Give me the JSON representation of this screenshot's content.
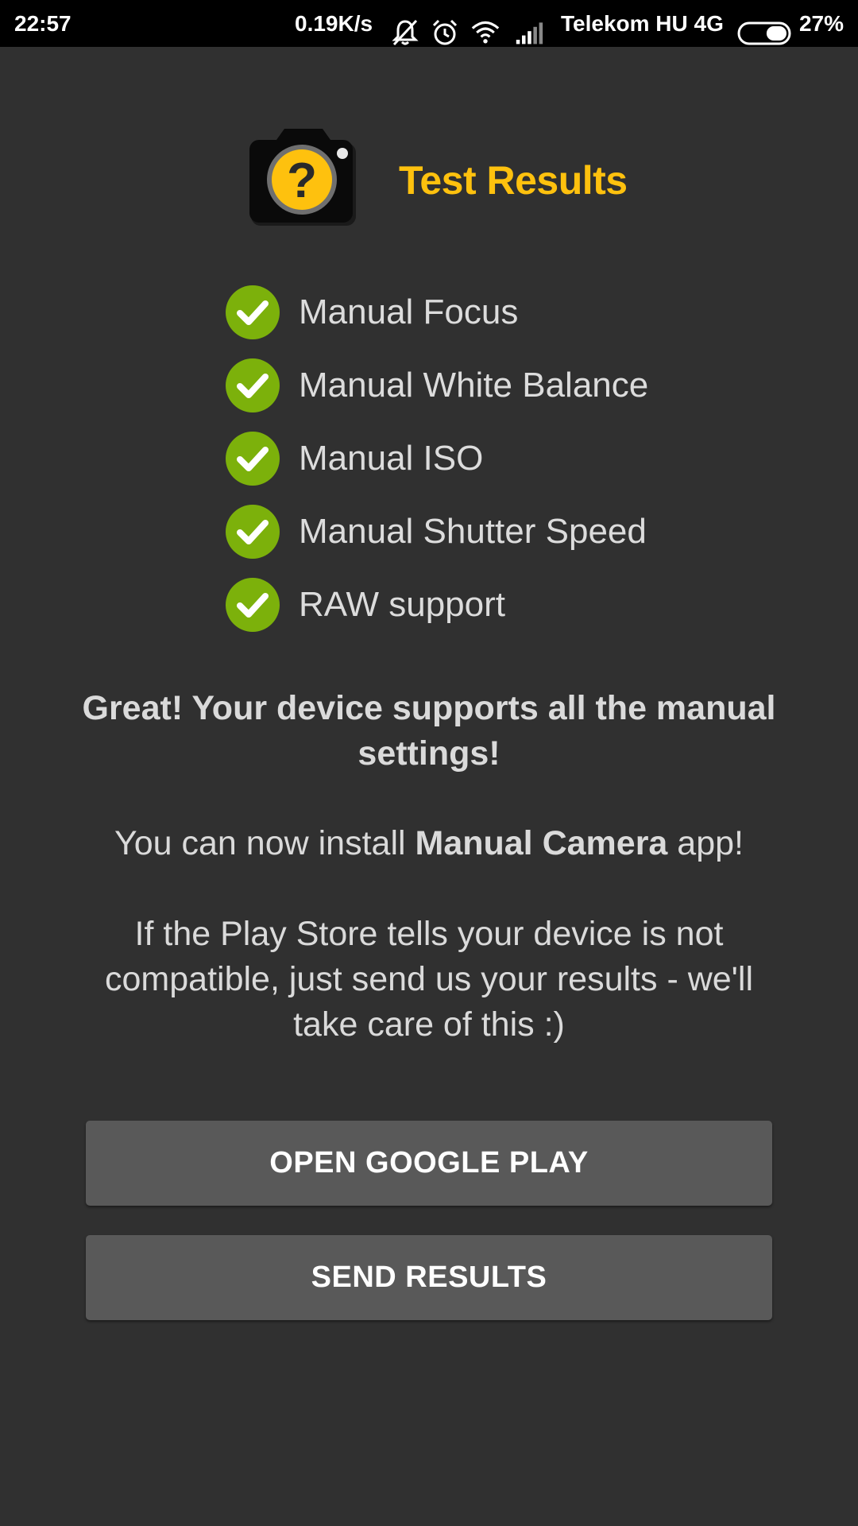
{
  "status_bar": {
    "time": "22:57",
    "net_speed": "0.19K/s",
    "carrier": "Telekom HU 4G",
    "battery_percent": "27%",
    "icons": [
      "mute-icon",
      "alarm-icon",
      "wifi-icon",
      "signal-icon",
      "battery-icon"
    ],
    "battery_level": 0.27
  },
  "header": {
    "title": "Test Results",
    "icon": "camera-question-icon",
    "title_color": "#fec10e"
  },
  "results": [
    {
      "label": "Manual Focus",
      "status": "supported"
    },
    {
      "label": "Manual White Balance",
      "status": "supported"
    },
    {
      "label": "Manual ISO",
      "status": "supported"
    },
    {
      "label": "Manual Shutter Speed",
      "status": "supported"
    },
    {
      "label": "RAW support",
      "status": "supported"
    }
  ],
  "messages": {
    "great": "Great! Your device supports all the manual settings!",
    "install_prefix": "You can now install ",
    "install_app": "Manual Camera",
    "install_suffix": " app!",
    "play_store": "If the Play Store tells your device is not compatible, just send us your results - we'll take care of this :)"
  },
  "buttons": {
    "open_google_play": "OPEN GOOGLE PLAY",
    "send_results": "SEND RESULTS"
  },
  "colors": {
    "background": "#303030",
    "accent": "#fec10e",
    "check": "#7cb10b",
    "button": "#595959"
  }
}
